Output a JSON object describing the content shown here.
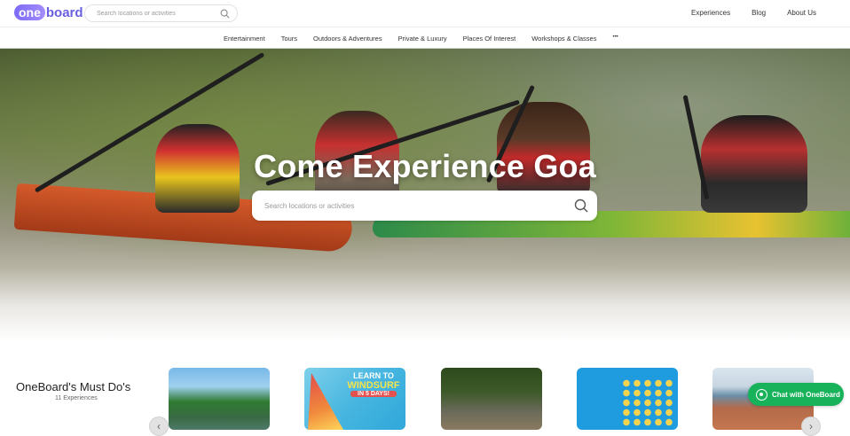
{
  "header": {
    "logo_part1": "one",
    "logo_part2": "board",
    "search_placeholder": "Search locations or activities",
    "links": [
      "Experiences",
      "Blog",
      "About Us"
    ]
  },
  "categories": {
    "items": [
      "Entertainment",
      "Tours",
      "Outdoors & Adventures",
      "Private & Luxury",
      "Places Of Interest",
      "Workshops & Classes"
    ],
    "more": "•••"
  },
  "hero": {
    "title": "Come Experience Goa",
    "search_placeholder": "Search locations or activities"
  },
  "must_dos": {
    "title": "OneBoard's Must Do's",
    "subtitle": "11 Experiences",
    "card2_line1": "LEARN TO",
    "card2_line2": "WINDSURF",
    "card2_line3": "IN 5 DAYS!"
  },
  "chat": {
    "label": "Chat with OneBoard"
  },
  "colors": {
    "brand": "#6a5fe0",
    "chat_green": "#17b25a"
  },
  "icons": [
    "search-icon",
    "whatsapp-icon",
    "chevron-left-icon",
    "chevron-right-icon",
    "more-icon"
  ]
}
